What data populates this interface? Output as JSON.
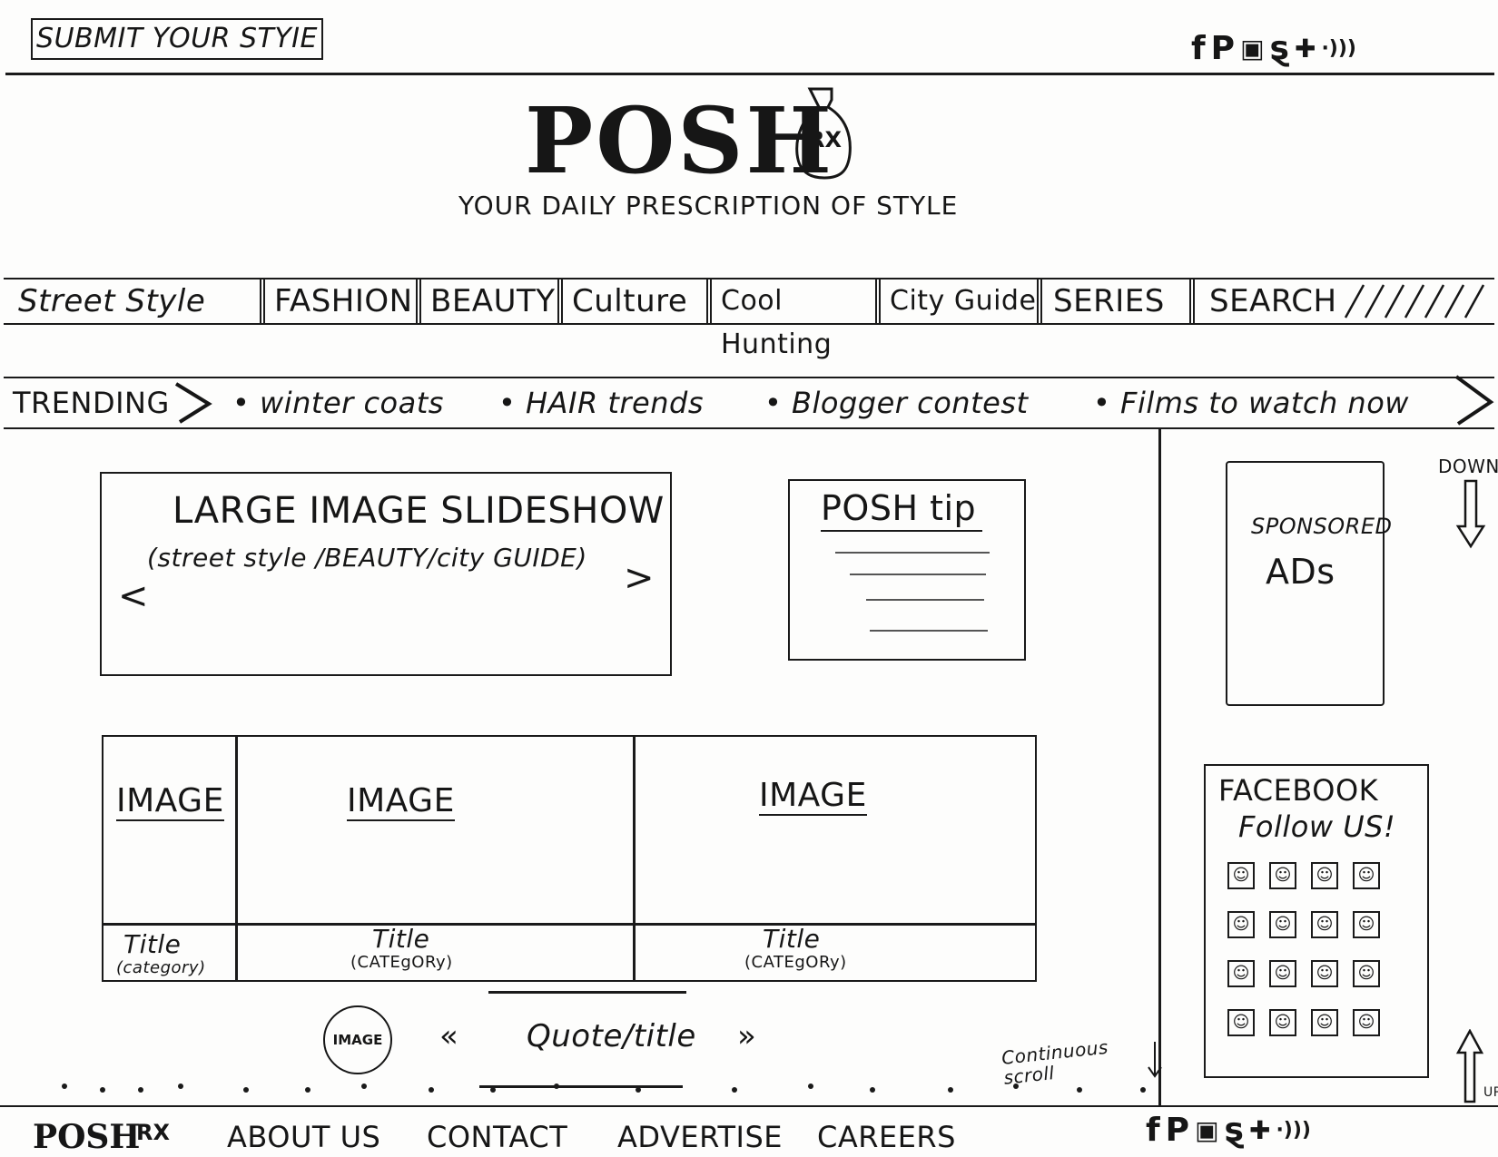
{
  "header": {
    "submit_label": "SUBMIT YOUR STYIE",
    "social_icons": [
      {
        "name": "facebook-icon",
        "glyph": "f"
      },
      {
        "name": "pinterest-icon",
        "glyph": "P"
      },
      {
        "name": "instagram-icon",
        "glyph": "▣"
      },
      {
        "name": "twitter-icon",
        "glyph": "ȿ"
      },
      {
        "name": "googleplus-icon",
        "glyph": "✚"
      },
      {
        "name": "rss-icon",
        "glyph": "·)))"
      }
    ]
  },
  "brand": {
    "logo": "POSH",
    "logo_mark": "RX",
    "tagline": "YOUR DAILY PRESCRIPTION OF STYLE"
  },
  "nav": {
    "items": [
      "Street Style",
      "FASHION",
      "BEAUTY",
      "Culture",
      "Cool Hunting",
      "City Guide",
      "SERIES"
    ],
    "search_label": "SEARCH"
  },
  "trending": {
    "label": "TRENDING",
    "items": [
      "winter coats",
      "HAIR trends",
      "Blogger contest",
      "Films to watch now"
    ]
  },
  "slideshow": {
    "title": "LARGE IMAGE SLIDESHOW",
    "subtitle": "(street style /BEAUTY/city GUIDE)",
    "prev": "<",
    "next": ">"
  },
  "tip": {
    "title": "POSH tip"
  },
  "ads": {
    "line1": "SPONSORED",
    "line2": "ADs"
  },
  "scroll": {
    "down_label": "DOWN",
    "up_label": "UP",
    "continuous_label": "Continuous scroll"
  },
  "cards": [
    {
      "image": "IMAGE",
      "title": "Title",
      "category": "(category)"
    },
    {
      "image": "IMAGE",
      "title": "Title",
      "category": "(CATEgORy)"
    },
    {
      "image": "IMAGE",
      "title": "Title",
      "category": "(CATEgORy)"
    }
  ],
  "quote": {
    "image_label": "IMAGE",
    "text": "Quote/title",
    "prev": "«",
    "next": "»"
  },
  "facebook": {
    "title": "FACEBOOK",
    "subtitle": "Follow US!",
    "face_glyph": "☺"
  },
  "footer": {
    "logo": "POSH",
    "logo_mark": "RX",
    "links": [
      "ABOUT US",
      "CONTACT",
      "ADVERTISE",
      "CAREERS"
    ]
  }
}
